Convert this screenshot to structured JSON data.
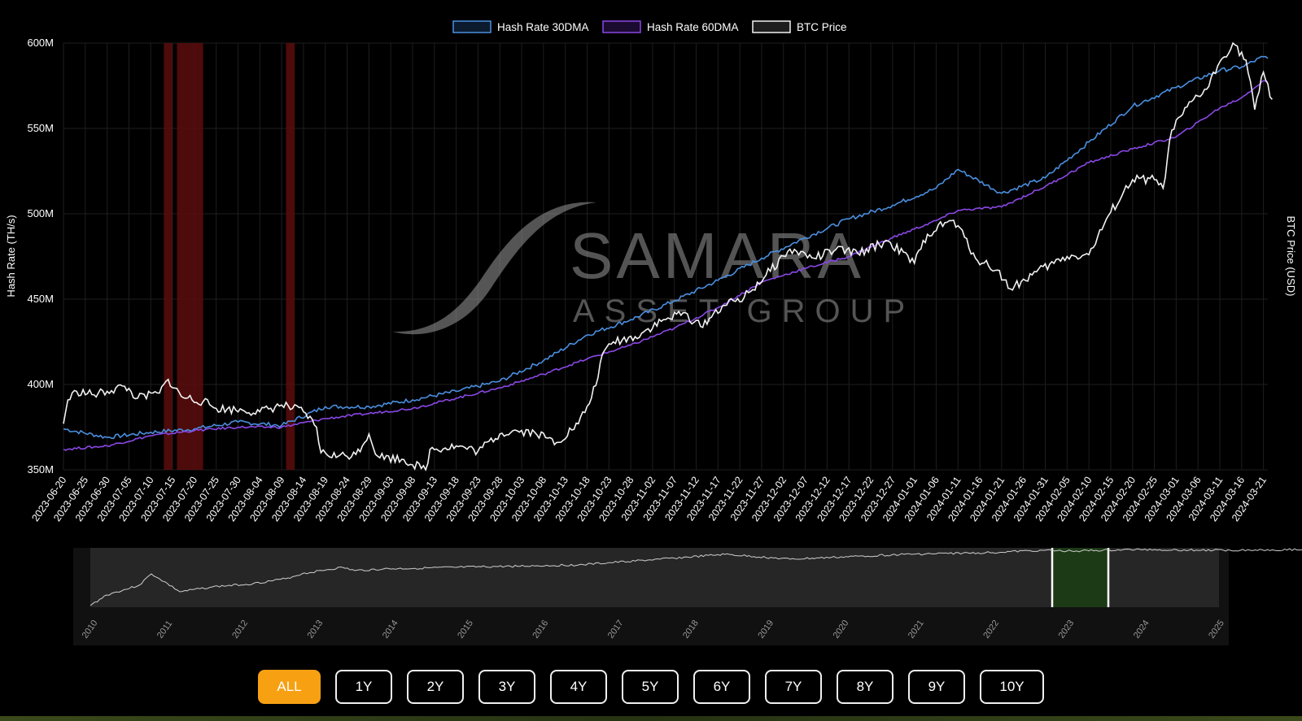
{
  "colors": {
    "bg": "#000000",
    "hash30": "#4a8fe0",
    "hash60": "#8a48e6",
    "btc": "#f2f2f2",
    "shade": "#5a0d0d",
    "grid": "#1e1e1e",
    "accent": "#f7a012",
    "navigator_selection": "#1d3a16"
  },
  "watermark": {
    "wordmark": "SAMARA",
    "subtitle": "ASSET GROUP"
  },
  "legend": [
    {
      "label": "Hash Rate 30DMA",
      "color": "#4a8fe0"
    },
    {
      "label": "Hash Rate 60DMA",
      "color": "#8a48e6"
    },
    {
      "label": "BTC Price",
      "color": "#f2f2f2"
    }
  ],
  "range_buttons": {
    "active": "ALL",
    "items": [
      "ALL",
      "1Y",
      "2Y",
      "3Y",
      "4Y",
      "5Y",
      "6Y",
      "7Y",
      "8Y",
      "9Y",
      "10Y"
    ]
  },
  "chart_data": {
    "type": "line",
    "ylabel": "Hash Rate (TH/s)",
    "y2label": "BTC Price (USD)",
    "ylim": [
      350,
      600
    ],
    "y_unit": "M",
    "y_ticks": [
      "350M",
      "400M",
      "450M",
      "500M",
      "550M",
      "600M"
    ],
    "grid": true,
    "legend_position": "top-center",
    "x_ticks": [
      "2023-06-20",
      "2023-06-25",
      "2023-06-30",
      "2023-07-05",
      "2023-07-10",
      "2023-07-15",
      "2023-07-20",
      "2023-07-25",
      "2023-07-30",
      "2023-08-04",
      "2023-08-09",
      "2023-08-14",
      "2023-08-19",
      "2023-08-24",
      "2023-08-29",
      "2023-09-03",
      "2023-09-08",
      "2023-09-13",
      "2023-09-18",
      "2023-09-23",
      "2023-09-28",
      "2023-10-03",
      "2023-10-08",
      "2023-10-13",
      "2023-10-18",
      "2023-10-23",
      "2023-10-28",
      "2023-11-02",
      "2023-11-07",
      "2023-11-12",
      "2023-11-17",
      "2023-11-22",
      "2023-11-27",
      "2023-12-02",
      "2023-12-07",
      "2023-12-12",
      "2023-12-17",
      "2023-12-22",
      "2023-12-27",
      "2024-01-01",
      "2024-01-06",
      "2024-01-11",
      "2024-01-16",
      "2024-01-21",
      "2024-01-26",
      "2024-01-31",
      "2024-02-05",
      "2024-02-10",
      "2024-02-15",
      "2024-02-20",
      "2024-02-25",
      "2024-03-01",
      "2024-03-06",
      "2024-03-11",
      "2024-03-16",
      "2024-03-21"
    ],
    "shaded_periods": [
      [
        "2023-07-13",
        "2023-07-15"
      ],
      [
        "2023-07-16",
        "2023-07-22"
      ],
      [
        "2023-08-10",
        "2023-08-12"
      ]
    ],
    "series": [
      {
        "name": "Hash Rate 30DMA",
        "x": [
          "2023-06-20",
          "2023-06-30",
          "2023-07-10",
          "2023-07-20",
          "2023-07-30",
          "2023-08-09",
          "2023-08-19",
          "2023-08-29",
          "2023-09-08",
          "2023-09-18",
          "2023-09-28",
          "2023-10-08",
          "2023-10-18",
          "2023-10-28",
          "2023-11-07",
          "2023-11-17",
          "2023-11-27",
          "2023-12-07",
          "2023-12-17",
          "2023-12-27",
          "2024-01-06",
          "2024-01-11",
          "2024-01-21",
          "2024-01-31",
          "2024-02-10",
          "2024-02-20",
          "2024-03-01",
          "2024-03-11",
          "2024-03-16",
          "2024-03-21",
          "2024-03-22"
        ],
        "values": [
          374,
          369,
          372,
          374,
          378,
          376,
          387,
          387,
          391,
          396,
          402,
          414,
          429,
          438,
          449,
          461,
          474,
          486,
          497,
          505,
          515,
          526,
          512,
          521,
          542,
          563,
          574,
          584,
          586,
          592,
          591
        ]
      },
      {
        "name": "Hash Rate 60DMA",
        "x": [
          "2023-06-20",
          "2023-06-30",
          "2023-07-10",
          "2023-07-20",
          "2023-07-30",
          "2023-08-09",
          "2023-08-19",
          "2023-08-29",
          "2023-09-08",
          "2023-09-18",
          "2023-09-28",
          "2023-10-08",
          "2023-10-18",
          "2023-10-28",
          "2023-11-07",
          "2023-11-17",
          "2023-11-27",
          "2023-12-07",
          "2023-12-17",
          "2023-12-27",
          "2024-01-06",
          "2024-01-11",
          "2024-01-21",
          "2024-01-31",
          "2024-02-10",
          "2024-02-20",
          "2024-03-01",
          "2024-03-11",
          "2024-03-16",
          "2024-03-21",
          "2024-03-22"
        ],
        "values": [
          362,
          364,
          370,
          373,
          375,
          375,
          380,
          383,
          386,
          392,
          398,
          406,
          415,
          423,
          433,
          445,
          460,
          468,
          475,
          486,
          496,
          502,
          504,
          516,
          530,
          538,
          545,
          562,
          568,
          578,
          577
        ]
      },
      {
        "name": "BTC Price",
        "x": [
          "2023-06-20",
          "2023-06-21",
          "2023-06-23",
          "2023-06-27",
          "2023-06-30",
          "2023-07-04",
          "2023-07-07",
          "2023-07-12",
          "2023-07-14",
          "2023-07-17",
          "2023-07-22",
          "2023-07-25",
          "2023-07-31",
          "2023-08-04",
          "2023-08-09",
          "2023-08-14",
          "2023-08-17",
          "2023-08-18",
          "2023-08-22",
          "2023-08-26",
          "2023-08-29",
          "2023-08-31",
          "2023-09-06",
          "2023-09-11",
          "2023-09-12",
          "2023-09-18",
          "2023-09-23",
          "2023-09-28",
          "2023-10-01",
          "2023-10-06",
          "2023-10-11",
          "2023-10-16",
          "2023-10-19",
          "2023-10-22",
          "2023-10-24",
          "2023-10-29",
          "2023-11-04",
          "2023-11-09",
          "2023-11-13",
          "2023-11-18",
          "2023-11-23",
          "2023-11-28",
          "2023-12-03",
          "2023-12-05",
          "2023-12-09",
          "2023-12-14",
          "2023-12-19",
          "2023-12-26",
          "2024-01-01",
          "2024-01-04",
          "2024-01-09",
          "2024-01-11",
          "2024-01-15",
          "2024-01-20",
          "2024-01-23",
          "2024-01-29",
          "2024-02-05",
          "2024-02-10",
          "2024-02-15",
          "2024-02-20",
          "2024-02-25",
          "2024-02-27",
          "2024-02-29",
          "2024-03-05",
          "2024-03-08",
          "2024-03-11",
          "2024-03-14",
          "2024-03-17",
          "2024-03-19",
          "2024-03-21",
          "2024-03-23"
        ],
        "values": [
          377,
          391,
          396,
          394,
          396,
          399,
          392,
          395,
          403,
          393,
          390,
          386,
          385,
          384,
          388,
          384,
          375,
          360,
          358,
          359,
          371,
          358,
          356,
          350,
          362,
          364,
          361,
          371,
          373,
          372,
          366,
          377,
          392,
          420,
          425,
          428,
          437,
          442,
          434,
          446,
          451,
          464,
          478,
          478,
          474,
          479,
          477,
          484,
          471,
          488,
          496,
          493,
          474,
          467,
          456,
          466,
          475,
          476,
          501,
          520,
          520,
          515,
          549,
          567,
          573,
          589,
          600,
          590,
          561,
          583,
          567
        ]
      }
    ]
  },
  "navigator": {
    "years": [
      "2010",
      "2011",
      "2012",
      "2013",
      "2014",
      "2015",
      "2016",
      "2017",
      "2018",
      "2019",
      "2020",
      "2021",
      "2022",
      "2023",
      "2024",
      "2025"
    ],
    "selection": [
      "2023-06-20",
      "2024-03-23"
    ]
  }
}
